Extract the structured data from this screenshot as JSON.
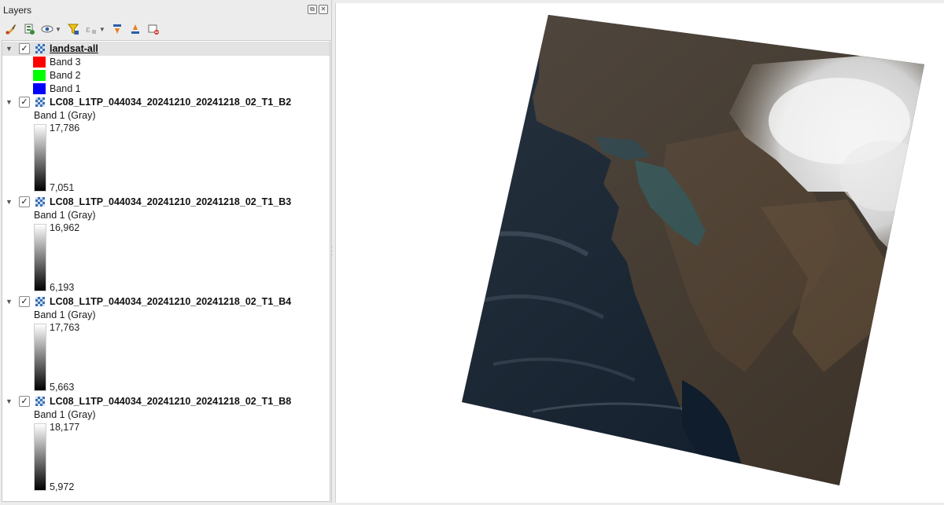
{
  "panel": {
    "title": "Layers"
  },
  "toolbar": {
    "icons": [
      "style-brush-icon",
      "add-group-icon",
      "visibility-eye-icon",
      "filter-icon",
      "expression-filter-icon",
      "expand-all-icon",
      "collapse-all-icon",
      "remove-layer-icon"
    ]
  },
  "layers": [
    {
      "name": "landsat-all",
      "checked": true,
      "bands": [
        {
          "label": "Band 3",
          "color": "#ff0000"
        },
        {
          "label": "Band 2",
          "color": "#00ff00"
        },
        {
          "label": "Band 1",
          "color": "#0000ff"
        }
      ]
    },
    {
      "name": "LC08_L1TP_044034_20241210_20241218_02_T1_B2",
      "checked": true,
      "band_label": "Band 1 (Gray)",
      "max": "17,786",
      "min": "7,051"
    },
    {
      "name": "LC08_L1TP_044034_20241210_20241218_02_T1_B3",
      "checked": true,
      "band_label": "Band 1 (Gray)",
      "max": "16,962",
      "min": "6,193"
    },
    {
      "name": "LC08_L1TP_044034_20241210_20241218_02_T1_B4",
      "checked": true,
      "band_label": "Band 1 (Gray)",
      "max": "17,763",
      "min": "5,663"
    },
    {
      "name": "LC08_L1TP_044034_20241210_20241218_02_T1_B8",
      "checked": true,
      "band_label": "Band 1 (Gray)",
      "max": "18,177",
      "min": "5,972"
    }
  ],
  "colors": {
    "ocean": "#0e1a28",
    "land": "#3a3126",
    "cloud": "#e8e8e8",
    "canvas_bg": "#ffffff"
  }
}
